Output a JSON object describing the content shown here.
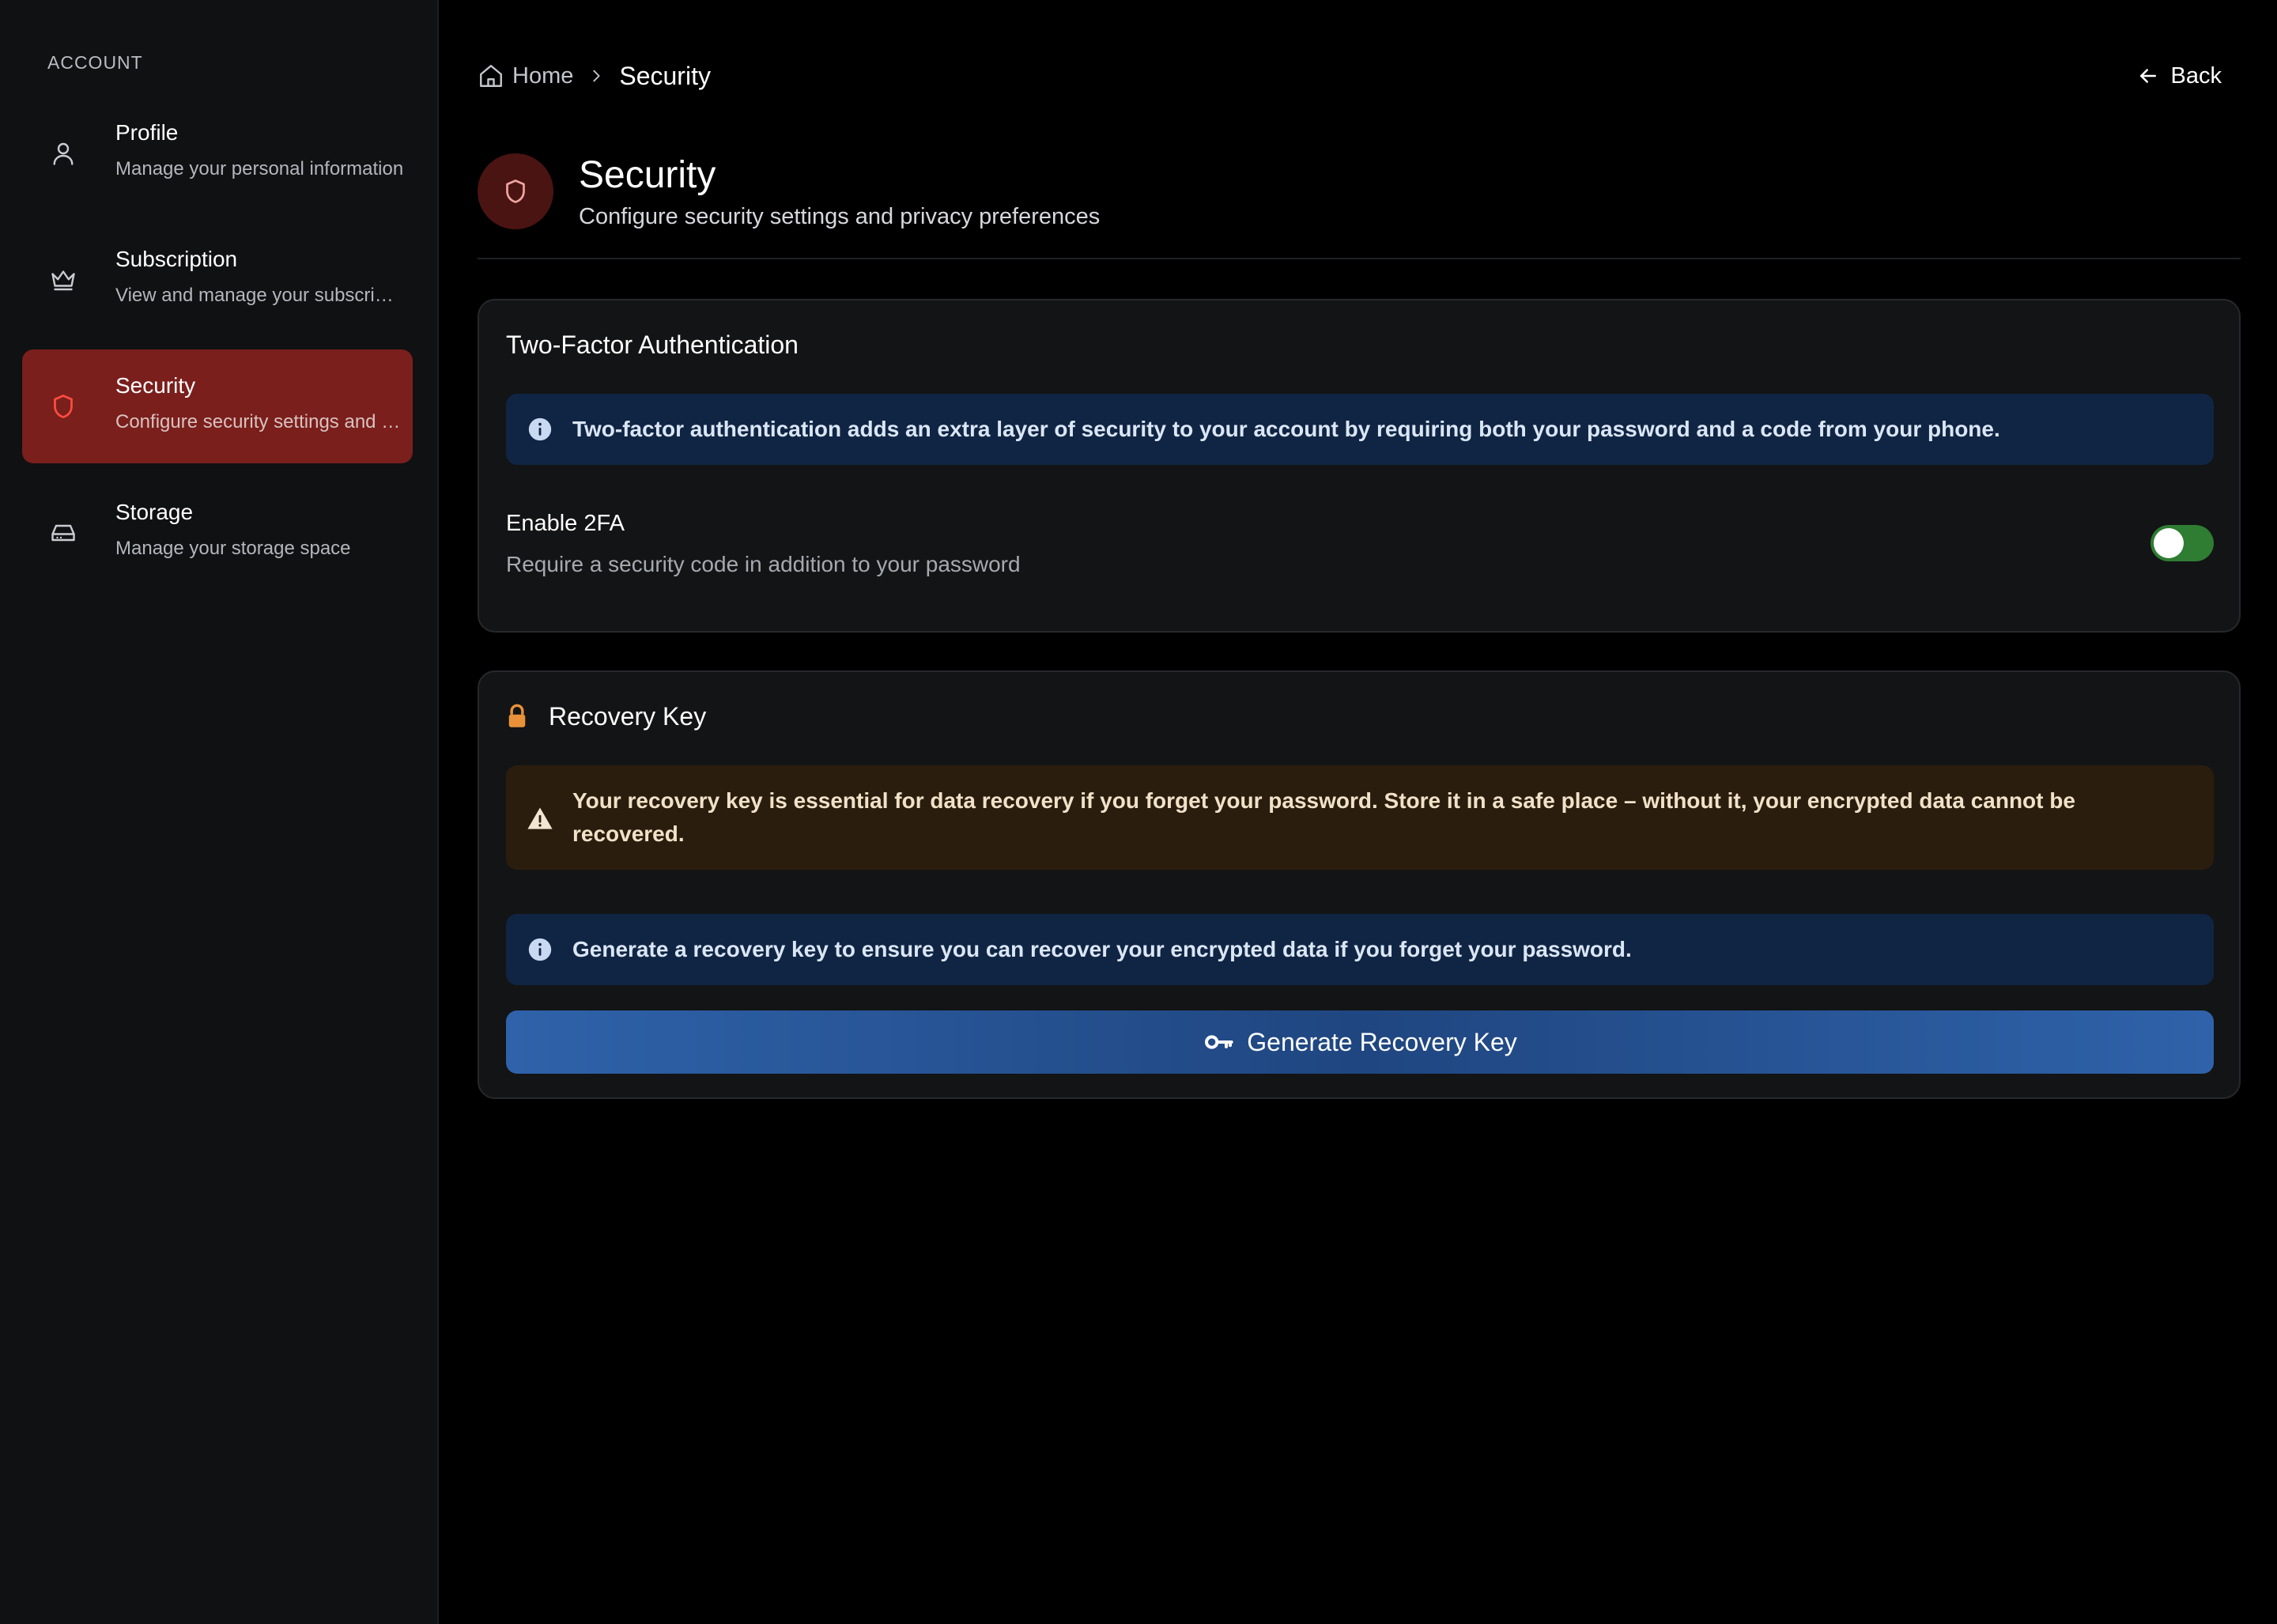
{
  "sidebar": {
    "section_title": "ACCOUNT",
    "items": [
      {
        "title": "Profile",
        "subtitle": "Manage your personal information",
        "icon": "user-icon"
      },
      {
        "title": "Subscription",
        "subtitle": "View and manage your subscription",
        "icon": "crown-icon"
      },
      {
        "title": "Security",
        "subtitle": "Configure security settings and privacy preferences",
        "icon": "shield-icon",
        "active": true
      },
      {
        "title": "Storage",
        "subtitle": "Manage your storage space",
        "icon": "hard-drive-icon"
      }
    ]
  },
  "breadcrumb": {
    "home": "Home",
    "current": "Security"
  },
  "header": {
    "back_label": "Back",
    "title": "Security",
    "subtitle": "Configure security settings and privacy preferences"
  },
  "two_factor": {
    "title": "Two-Factor Authentication",
    "info": "Two-factor authentication adds an extra layer of security to your account by requiring both your password and a code from your phone.",
    "enable_label": "Enable 2FA",
    "enable_description": "Require a security code in addition to your password",
    "enabled": false
  },
  "recovery": {
    "title": "Recovery Key",
    "warning": "Your recovery key is essential for data recovery if you forget your password. Store it in a safe place – without it, your encrypted data cannot be recovered.",
    "info": "Generate a recovery key to ensure you can recover your encrypted data if you forget your password.",
    "button_label": "Generate Recovery Key"
  },
  "colors": {
    "active_nav": "#7a1f1c",
    "info_bg": "#102544",
    "warn_bg": "#2b1d0d",
    "toggle": "#2e7d32",
    "button": "#2f62aa",
    "lock_icon": "#e8913a"
  }
}
